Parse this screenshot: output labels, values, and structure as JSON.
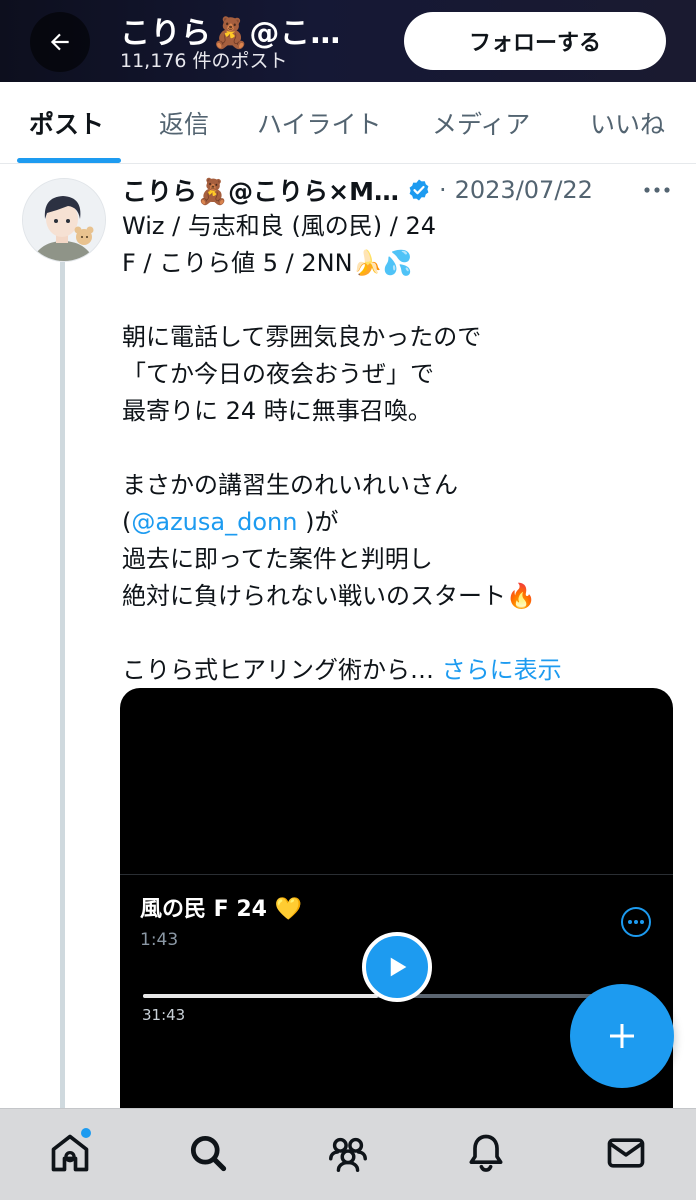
{
  "header": {
    "back_label": "",
    "display_name": "こりら🧸@こ…",
    "post_count": "11,176 件のポスト",
    "follow_label": "フォローする"
  },
  "tabs": [
    {
      "label": "ポスト",
      "active": true
    },
    {
      "label": "返信",
      "active": false
    },
    {
      "label": "ハイライト",
      "active": false
    },
    {
      "label": "メディア",
      "active": false
    },
    {
      "label": "いいね",
      "active": false
    }
  ],
  "post": {
    "author_name": "こりら🧸@こりら×M…",
    "separator": "·",
    "date": "2023/07/22",
    "lines": [
      "Wiz / 与志和良 (風の民) / 24",
      " F / こりら値 5 / 2NN🍌💦",
      "",
      "朝に電話して雰囲気良かったので",
      "「てか今日の夜会おうぜ」で",
      "最寄りに 24 時に無事召喚。",
      "",
      "まさかの講習生のれいれいさん",
      "",
      "過去に即ってた案件と判明し",
      "絶対に負けられない戦いのスタート🔥",
      "",
      "こりら式ヒアリング術から…"
    ],
    "mention_prefix": "(",
    "mention": "@azusa_donn",
    "mention_suffix": " )が",
    "show_more": "さらに表示"
  },
  "media": {
    "title": "風の民 F 24 💛",
    "current_time": "1:43",
    "total_time": "31:43",
    "progress": 0.5
  },
  "icons": {
    "back": "arrow-left-icon",
    "verified": "verified-badge-icon",
    "more": "more-horizontal-icon",
    "play": "play-icon",
    "media_options": "more-circle-icon",
    "compose": "plus-icon",
    "nav": [
      "home-icon",
      "search-icon",
      "communities-icon",
      "bell-icon",
      "mail-icon"
    ]
  },
  "colors": {
    "accent": "#1d9bf0",
    "header_bg": "#151835",
    "text": "#0f1419",
    "secondary_text": "#536471"
  }
}
